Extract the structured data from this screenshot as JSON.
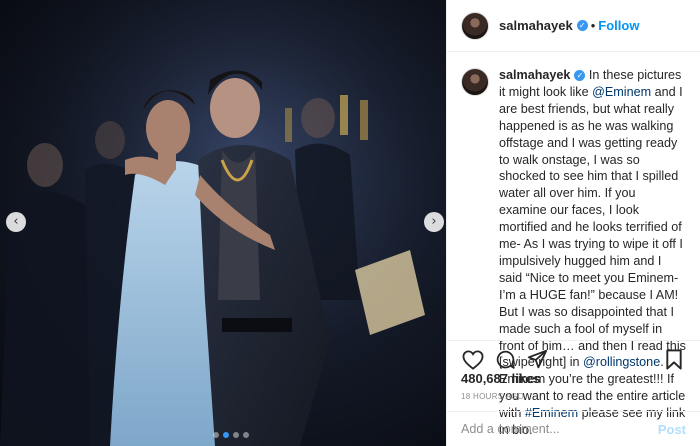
{
  "post": {
    "username": "salmahayek",
    "follow_label": "Follow",
    "separator": "•",
    "verified_mark": "✓",
    "caption": {
      "username": "salmahayek",
      "part1": " In these pictures it might look like ",
      "mention1": "@Eminem",
      "part2": " and I are best friends, but what really happened is as he was walking offstage and I was getting ready to walk onstage, I was so shocked to see him that I spilled water all over him. If you examine our faces, I look mortified and he looks terrified of me- As I was trying to wipe it off I impulsively hugged him and I said “Nice to meet you Eminem- I’m a HUGE fan!” because I AM! But I was so disappointed that I made such a fool of myself in front of him… and then I read this [swipe right] in ",
      "mention2": "@rollingstone",
      "part3": ". Eminem you’re the greatest!!! If you want to read the entire article with ",
      "hashtag": "#Eminem",
      "part4": " please see my link in bio."
    },
    "likes": "480,687 likes",
    "timestamp": "18 HOURS AGO",
    "comment_placeholder": "Add a comment...",
    "post_label": "Post",
    "carousel": {
      "prev": "‹",
      "next": "›",
      "slide_count": 4,
      "active_slide": 1
    }
  },
  "icons": {
    "like": "heart-icon",
    "comment": "comment-icon",
    "share": "share-icon",
    "save": "bookmark-icon",
    "verified": "verified-badge-icon"
  },
  "colors": {
    "accent": "#0095f6",
    "verified": "#3897f0",
    "link": "#00376b",
    "muted": "#8e8e8e",
    "post_disabled": "#b2dffc"
  }
}
